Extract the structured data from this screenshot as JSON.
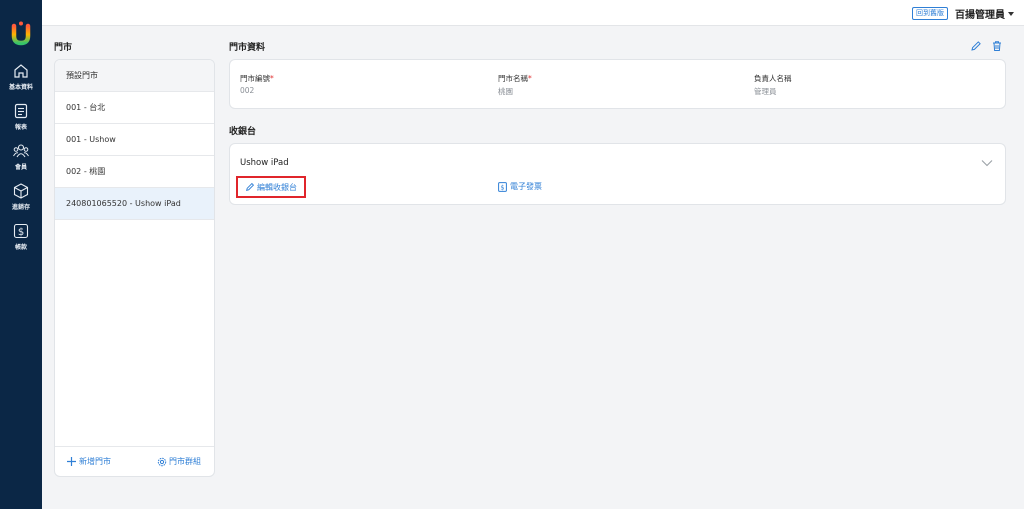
{
  "nav": {
    "items": [
      {
        "label": "基本資料",
        "icon": "home-icon"
      },
      {
        "label": "報表",
        "icon": "report-icon"
      },
      {
        "label": "會員",
        "icon": "members-icon"
      },
      {
        "label": "進銷存",
        "icon": "inventory-icon"
      },
      {
        "label": "帳款",
        "icon": "dollar-icon"
      }
    ]
  },
  "topbar": {
    "old_version_label": "回到舊版",
    "user_name": "百揚管理員"
  },
  "stores": {
    "title": "門市",
    "header": "預設門市",
    "items": [
      "001 - 台北",
      "001 - Ushow",
      "002 - 桃園",
      "240801065520 - Ushow iPad"
    ],
    "add_label": "新增門市",
    "group_label": "門市群組"
  },
  "store_info": {
    "title": "門市資料",
    "fields": [
      {
        "label": "門市編號",
        "required": true,
        "value": "002"
      },
      {
        "label": "門市名稱",
        "required": true,
        "value": "桃園"
      },
      {
        "label": "負責人名稱",
        "required": false,
        "value": "管理員"
      }
    ]
  },
  "registers": {
    "title": "收銀台",
    "name": "Ushow iPad",
    "edit_label": "編輯收銀台",
    "invoice_label": "電子發票"
  },
  "colors": {
    "nav_bg": "#0b2746",
    "accent": "#2f7fd6",
    "highlight": "#e0252b",
    "selected_row": "#e9f2fb"
  }
}
